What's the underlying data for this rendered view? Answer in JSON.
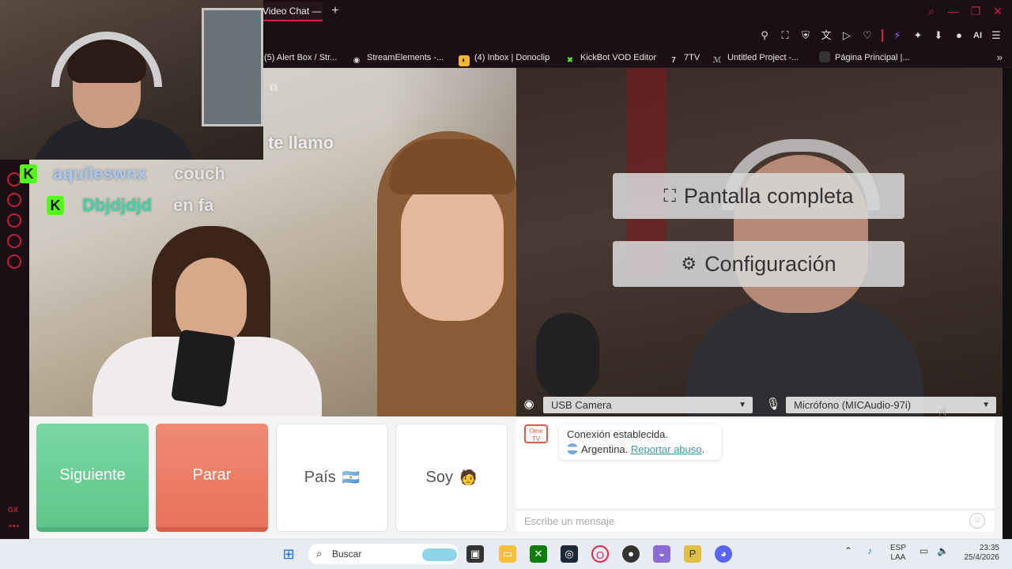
{
  "browser": {
    "tab_title": "Video Chat —",
    "new_tab": "+",
    "toolbar_ai": "AI"
  },
  "bookmarks": [
    {
      "label": "(5) Alert Box / Str...",
      "icon": "partial-icon"
    },
    {
      "label": "StreamElements -...",
      "icon": "streamelements-icon"
    },
    {
      "label": "(4) Inbox | Donoclip",
      "icon": "donoclip-icon"
    },
    {
      "label": "KickBot VOD Editor",
      "icon": "kickbot-icon"
    },
    {
      "label": "7TV",
      "icon": "7tv-icon"
    },
    {
      "label": "Untitled Project -...",
      "icon": "project-icon"
    },
    {
      "label": "Página Principal |...",
      "icon": "page-icon"
    }
  ],
  "stream_overlay": {
    "partial_text": "te llamo",
    "chat": [
      {
        "user": "aquileswnx",
        "message": "couch",
        "user_color": "#a8c8f0"
      },
      {
        "user": "Dbjdjdjd",
        "message": "en fa",
        "user_color": "#3fd3a8"
      }
    ],
    "badge_letter": "K"
  },
  "video": {
    "fullscreen_label": "Pantalla completa",
    "settings_label": "Configuración",
    "camera_select": "USB Camera",
    "mic_select": "Micrófono (MICAudio-97i)"
  },
  "controls": {
    "next_label": "Siguiente",
    "stop_label": "Parar",
    "country_label": "País",
    "country_flag": "🇦🇷",
    "gender_label": "Soy",
    "gender_emoji": "🧑"
  },
  "chat": {
    "logo_text": "Ome TV",
    "status": "Conexión establecida.",
    "country": "Argentina.",
    "report_link": "Reportar abuso",
    "report_suffix": ".",
    "input_placeholder": "Escribe un mensaje"
  },
  "taskbar": {
    "search_placeholder": "Buscar",
    "lang_line1": "ESP",
    "lang_line2": "LAA",
    "time": "23:35",
    "date": "25/4/2026",
    "sidebar_gx": "GX"
  },
  "colors": {
    "accent": "#d21f4a",
    "next_green": "#5ec68b",
    "stop_red": "#e9735b",
    "kick_green": "#53fc18"
  }
}
